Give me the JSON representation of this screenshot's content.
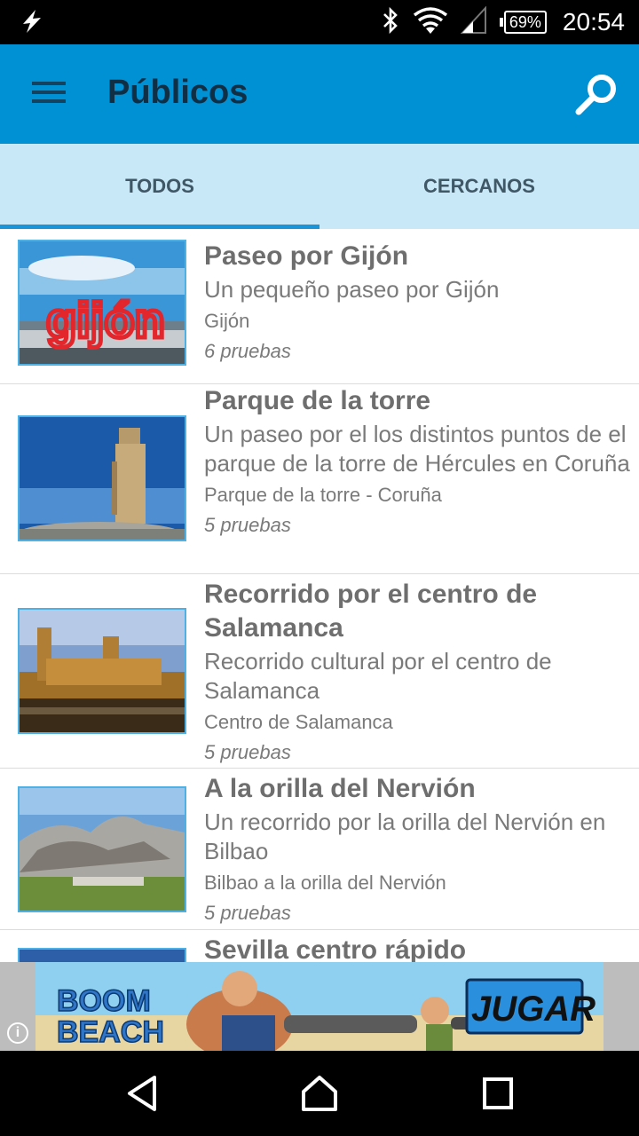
{
  "status_bar": {
    "battery": "69%",
    "time": "20:54"
  },
  "app_bar": {
    "title": "Públicos"
  },
  "tabs": [
    {
      "label": "TODOS",
      "active": true
    },
    {
      "label": "CERCANOS",
      "active": false
    }
  ],
  "items": [
    {
      "title": "Paseo por Gijón",
      "description": "Un pequeño paseo por Gijón",
      "location": "Gijón",
      "count": "6 pruebas",
      "thumbnail_text": "gijón"
    },
    {
      "title": "Parque de la torre",
      "description": "Un paseo por el los distintos puntos de el parque de la torre de Hércules en Coruña",
      "location": "Parque de la torre - Coruña",
      "count": "5 pruebas"
    },
    {
      "title": "Recorrido por el centro de Salamanca",
      "description": "Recorrido cultural por el centro de Salamanca",
      "location": "Centro de Salamanca",
      "count": "5 pruebas"
    },
    {
      "title": "A la orilla del Nervión",
      "description": "Un recorrido por la orilla del Nervión en Bilbao",
      "location": "Bilbao a la orilla del Nervión",
      "count": "5 pruebas"
    },
    {
      "title": "Sevilla centro rápido"
    }
  ],
  "ad": {
    "brand_line1": "BOOM",
    "brand_line2": "BEACH",
    "cta": "JUGAR",
    "info": "i"
  },
  "colors": {
    "app_bar": "#0090d4",
    "tabs_bg": "#c8e7f7",
    "tab_indicator": "#1a96d8",
    "thumb_border": "#4db1e6"
  }
}
